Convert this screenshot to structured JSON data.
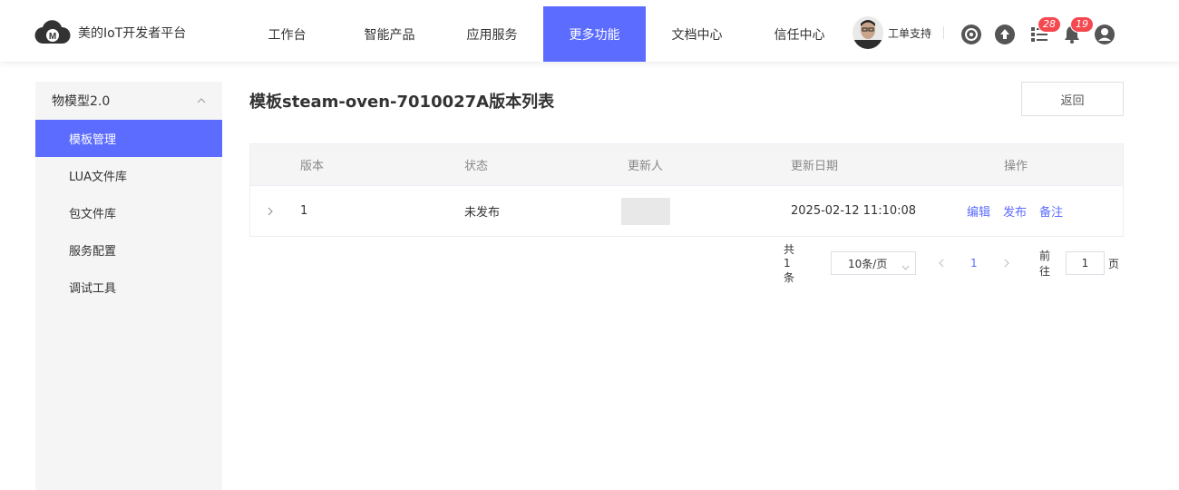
{
  "brand": {
    "name": "美的IoT开发者平台"
  },
  "nav": {
    "items": [
      {
        "label": "工作台"
      },
      {
        "label": "智能产品"
      },
      {
        "label": "应用服务"
      },
      {
        "label": "更多功能",
        "active": true
      },
      {
        "label": "文档中心"
      },
      {
        "label": "信任中心"
      }
    ]
  },
  "header": {
    "user_name": "工单支持",
    "icons": [
      "target-icon",
      "upload-icon",
      "task-list-icon",
      "bell-icon",
      "user-icon"
    ],
    "task_badge": "28",
    "bell_badge": "19"
  },
  "sidebar": {
    "group_label": "物模型2.0",
    "items": [
      {
        "label": "模板管理",
        "active": true
      },
      {
        "label": "LUA文件库"
      },
      {
        "label": "包文件库"
      },
      {
        "label": "服务配置"
      },
      {
        "label": "调试工具"
      }
    ]
  },
  "main": {
    "title": "模板steam-oven-7010027A版本列表",
    "back_label": "返回"
  },
  "table": {
    "headers": [
      "版本",
      "状态",
      "更新人",
      "更新日期",
      "操作"
    ],
    "rows": [
      {
        "version": "1",
        "status": "未发布",
        "updater": "",
        "updated_at": "2025-02-12 11:10:08",
        "ops": [
          "编辑",
          "发布",
          "备注"
        ]
      }
    ]
  },
  "pagination": {
    "total": "共 1 条",
    "page_size": "10条/页",
    "current_page": "1",
    "goto_label": "前往",
    "goto_value": "1",
    "page_suffix": "页"
  },
  "colors": {
    "accent": "#5b6cff",
    "badge": "#f5484f",
    "sidebar_bg": "#f5f5f5"
  }
}
